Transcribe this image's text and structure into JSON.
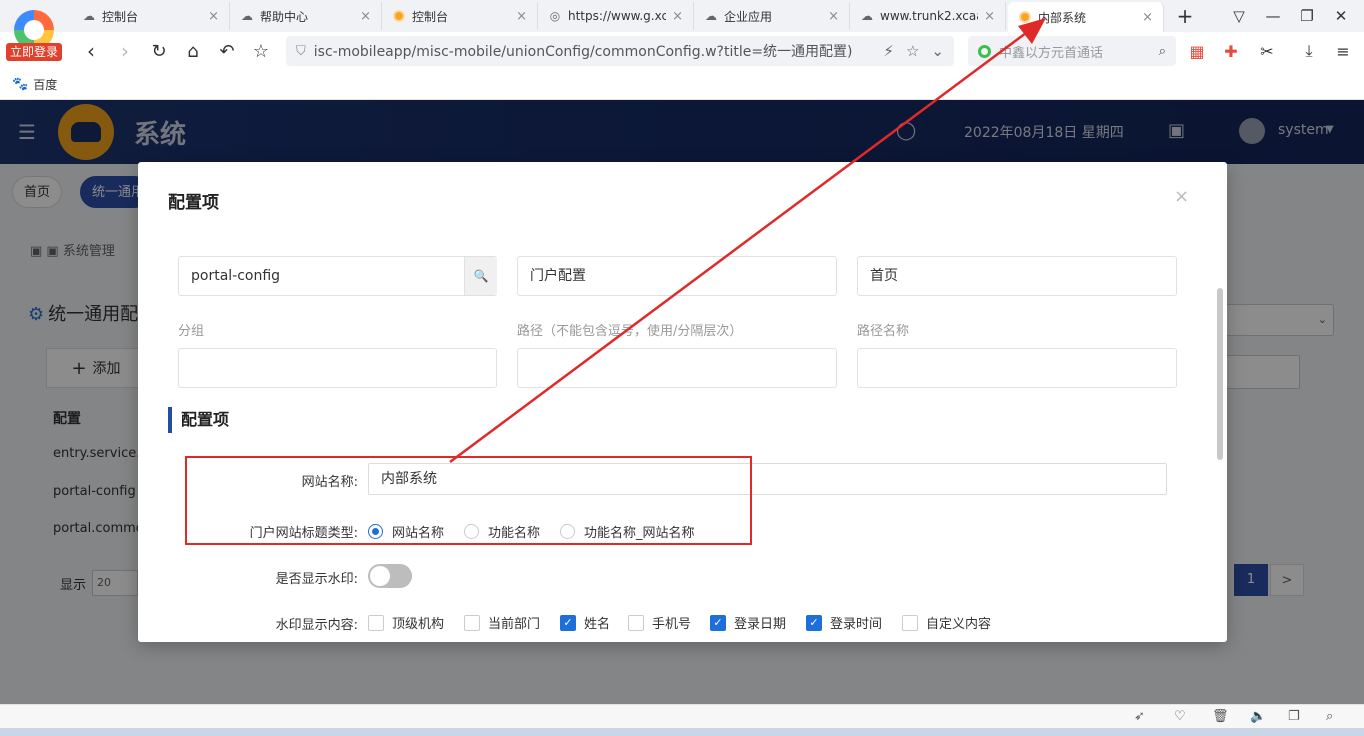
{
  "browser": {
    "login_badge": "立即登录",
    "tabs": [
      {
        "label": "控制台",
        "icon": "cloud-icon"
      },
      {
        "label": "帮助中心",
        "icon": "cloud-icon"
      },
      {
        "label": "控制台",
        "icon": "orange-app-icon"
      },
      {
        "label": "https://www.g.xca",
        "icon": "globe-icon"
      },
      {
        "label": "企业应用",
        "icon": "cloud-icon"
      },
      {
        "label": "www.trunk2.xcaa",
        "icon": "cloud-icon"
      },
      {
        "label": "内部系统",
        "icon": "orange-app-icon"
      }
    ],
    "new_tab": "+",
    "address": "isc-mobileapp/misc-mobile/unionConfig/commonConfig.w?title=统一通用配置)",
    "search_placeholder": "中鑫以方元首通话",
    "bookmark": "百度"
  },
  "app": {
    "title": "系统",
    "date": "2022年08月18日 星期四",
    "user": "system",
    "tabs": [
      "首页",
      "统一通用"
    ],
    "breadcrumb": "系统管理",
    "page_title": "统一通用配",
    "add_button": "添加",
    "table_header": "配置",
    "rows": [
      "entry.service.a",
      "portal-config",
      "portal.commo"
    ],
    "pagesize_label": "显示",
    "pagesize_value": "20",
    "current_page": "1",
    "next_page": ">"
  },
  "modal": {
    "title": "配置项",
    "close": "×",
    "fields": {
      "group_value": "portal-config",
      "path_value": "门户配置",
      "path_name_value": "首页",
      "group_label": "分组",
      "path_label": "路径（不能包含逗号，使用/分隔层次）",
      "path_name_label": "路径名称",
      "group_input": "",
      "path_input": "",
      "path_name_input": ""
    },
    "section_title": "配置项",
    "site_name_label": "网站名称:",
    "site_name_value": "内部系统",
    "title_type_label": "门户网站标题类型:",
    "title_type_options": [
      {
        "label": "网站名称",
        "checked": true
      },
      {
        "label": "功能名称",
        "checked": false
      },
      {
        "label": "功能名称_网站名称",
        "checked": false
      }
    ],
    "watermark_label": "是否显示水印:",
    "watermark_enabled": false,
    "watermark_content_label": "水印显示内容:",
    "watermark_options": [
      {
        "label": "顶级机构",
        "checked": false
      },
      {
        "label": "当前部门",
        "checked": false
      },
      {
        "label": "姓名",
        "checked": true
      },
      {
        "label": "手机号",
        "checked": false
      },
      {
        "label": "登录日期",
        "checked": true
      },
      {
        "label": "登录时间",
        "checked": true
      },
      {
        "label": "自定义内容",
        "checked": false
      }
    ]
  },
  "annotation": {
    "color": "#e02a2a"
  }
}
